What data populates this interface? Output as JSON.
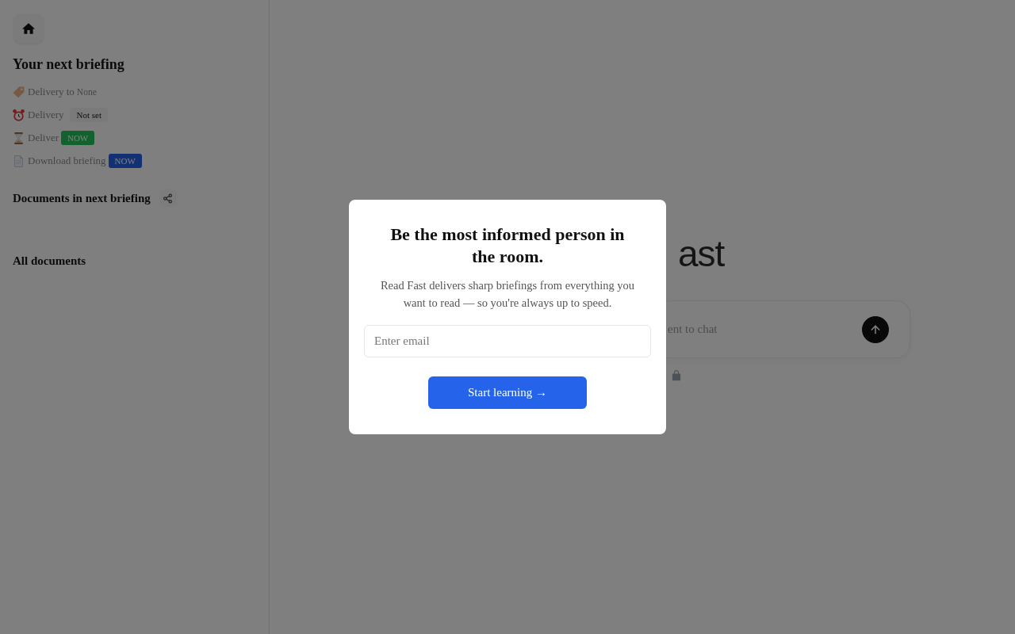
{
  "sidebar": {
    "heading": "Your next briefing",
    "items": [
      {
        "kind": "value",
        "label": "Delivery to",
        "value": "None"
      },
      {
        "kind": "status",
        "label": "Delivery",
        "value": "Not set"
      },
      {
        "kind": "badge",
        "label": "Deliver",
        "value": "NOW",
        "color": "#11622f"
      },
      {
        "kind": "badge",
        "label": "Download briefing",
        "value": "NOW",
        "color": "#123175"
      }
    ],
    "documents_heading": "Documents in next briefing",
    "all_documents_heading": "All documents"
  },
  "main": {
    "logo": "ast",
    "chat": {
      "placeholder": "ent to chat"
    }
  },
  "modal": {
    "title": "Be the most informed person in the room.",
    "description": "Read Fast delivers sharp briefings from everything you want to read — so you're always up to speed.",
    "email": {
      "placeholder": "Enter email"
    },
    "button": "Start learning →"
  }
}
